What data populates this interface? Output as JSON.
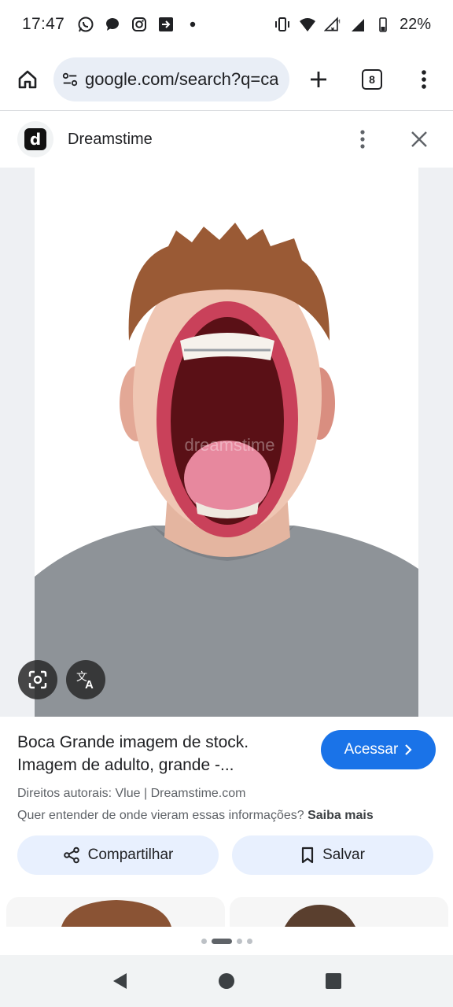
{
  "status_bar": {
    "time": "17:47",
    "battery": "22%",
    "left_icons": [
      "whatsapp-icon",
      "chat-bubble-icon",
      "instagram-icon",
      "arrow-box-icon",
      "dot-icon"
    ],
    "right_icons": [
      "vibrate-icon",
      "wifi-icon",
      "signal-icon",
      "battery-icon"
    ]
  },
  "browser": {
    "url": "google.com/search?q=ca",
    "tab_count": "8"
  },
  "source": {
    "name": "Dreamstime",
    "logo_letter": "d"
  },
  "image": {
    "watermark": "dreamstime"
  },
  "result": {
    "title_line1": "Boca Grande imagem de stock.",
    "title_line2": "Imagem de adulto, grande -...",
    "visit_label": "Acessar",
    "rights": "Direitos autorais: Vlue | Dreamstime.com",
    "question": "Quer entender de onde vieram essas informações?",
    "learn_more": "Saiba mais",
    "share_label": "Compartilhar",
    "save_label": "Salvar"
  },
  "colors": {
    "accent": "#1a73e8",
    "pill": "#e8f0fe",
    "url_bar": "#e9eef6"
  }
}
